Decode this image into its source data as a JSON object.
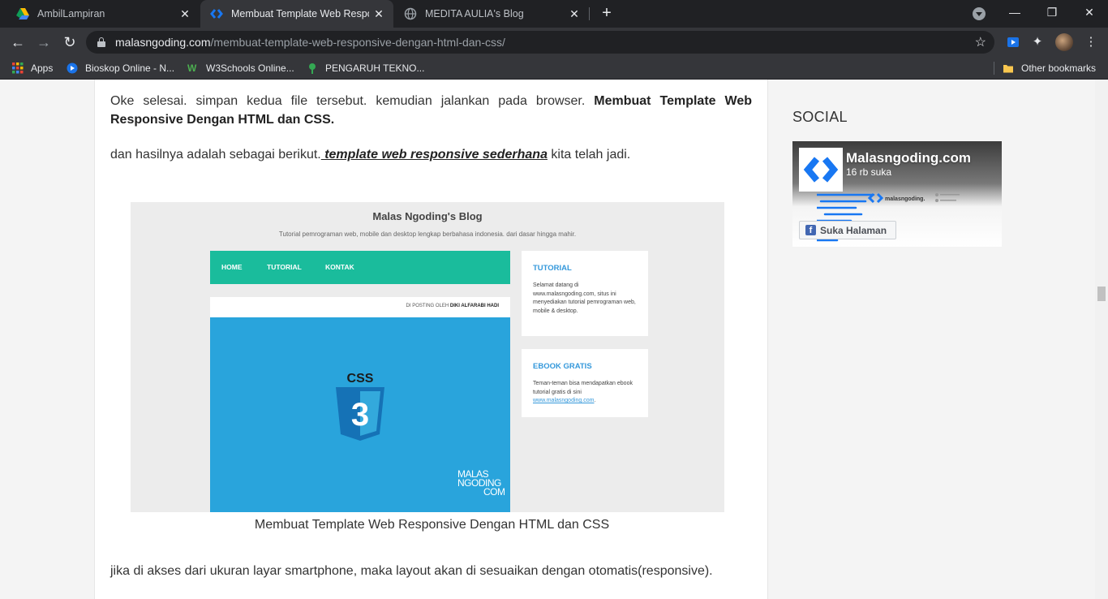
{
  "tabs": [
    {
      "title": "AmbilLampiran",
      "icon": "drive-icon",
      "active": false
    },
    {
      "title": "Membuat Template Web Respon",
      "icon": "malasngoding-icon",
      "active": true
    },
    {
      "title": "MEDITA AULIA's Blog",
      "icon": "globe-icon",
      "active": false
    }
  ],
  "toolbar": {
    "url_host": "malasngoding.com",
    "url_path": "/membuat-template-web-responsive-dengan-html-dan-css/"
  },
  "bookmarks": [
    {
      "label": "Apps",
      "icon": "apps-grid-icon"
    },
    {
      "label": "Bioskop Online - N...",
      "icon": "play-icon"
    },
    {
      "label": "W3Schools Online...",
      "icon": "w3schools-icon"
    },
    {
      "label": "PENGARUH TEKNO...",
      "icon": "tree-icon"
    }
  ],
  "other_bookmarks": "Other bookmarks",
  "article": {
    "para1_text": "Oke selesai. simpan kedua file tersebut. kemudian jalankan pada browser. ",
    "para1_bold": "Membuat Template Web Responsive Dengan HTML dan CSS.",
    "para2_pre": "dan hasilnya adalah sebagai berikut.",
    "para2_link": " template web responsive sederhana",
    "para2_post": " kita telah jadi.",
    "figure": {
      "title": "Malas Ngoding's Blog",
      "subtitle": "Tutorial pemrograman web, mobile dan desktop lengkap berbahasa indonesia. dari dasar hingga mahir.",
      "nav": [
        "HOME",
        "TUTORIAL",
        "KONTAK"
      ],
      "posted_by_label": "DI POSTING OLEH ",
      "posted_by_name": "DIKI ALFARABI HADI",
      "css_label": "CSS",
      "css_number": "3",
      "watermark_1": "MALAS",
      "watermark_2": "NGODING",
      "watermark_3": "COM",
      "side1_title": "TUTORIAL",
      "side1_text": "Selamat datang di www.malasngoding.com, situs ini menyediakan tutorial pemrograman web, mobile & desktop.",
      "side2_title": "EBOOK GRATIS",
      "side2_text": "Teman-teman bisa mendapatkan ebook tutorial gratis di sini ",
      "side2_link": "www.malasngoding.com",
      "side2_end": "."
    },
    "caption": "Membuat Template Web Responsive Dengan HTML dan CSS",
    "para3": "jika di akses dari ukuran layar smartphone, maka layout akan di sesuaikan dengan otomatis(responsive)."
  },
  "sidebar": {
    "title": "SOCIAL",
    "fb_page_name": "Malasngoding.com",
    "fb_likes": "16 rb suka",
    "fb_banner_text": "malasngoding.",
    "fb_button": "Suka Halaman"
  },
  "colors": {
    "nav_green": "#1abc9c",
    "css_blue": "#29a4dc",
    "side_title_blue": "#3498db",
    "brand_blue": "#1877f2"
  }
}
